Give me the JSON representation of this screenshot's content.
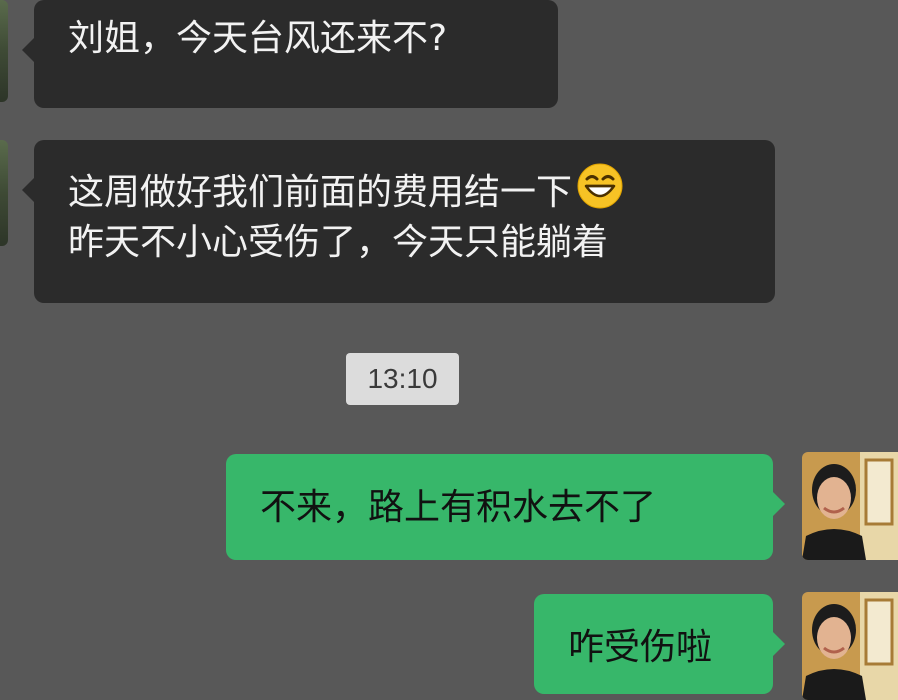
{
  "messages": [
    {
      "direction": "incoming",
      "lines": [
        "刘姐，今天台风还来不?"
      ]
    },
    {
      "direction": "incoming",
      "lines": [
        "这周做好我们前面的费用结一下",
        "昨天不小心受伤了，今天只能躺着"
      ],
      "emoji": "grinning-face-emoji"
    },
    {
      "direction": "outgoing",
      "lines": [
        "不来，路上有积水去不了"
      ]
    },
    {
      "direction": "outgoing",
      "lines": [
        "咋受伤啦"
      ]
    }
  ],
  "timestamp": "13:10",
  "colors": {
    "background": "#585858",
    "incoming_bubble": "#2b2b2b",
    "outgoing_bubble": "#37b76a",
    "timestamp_bg": "#dcdcdc"
  }
}
